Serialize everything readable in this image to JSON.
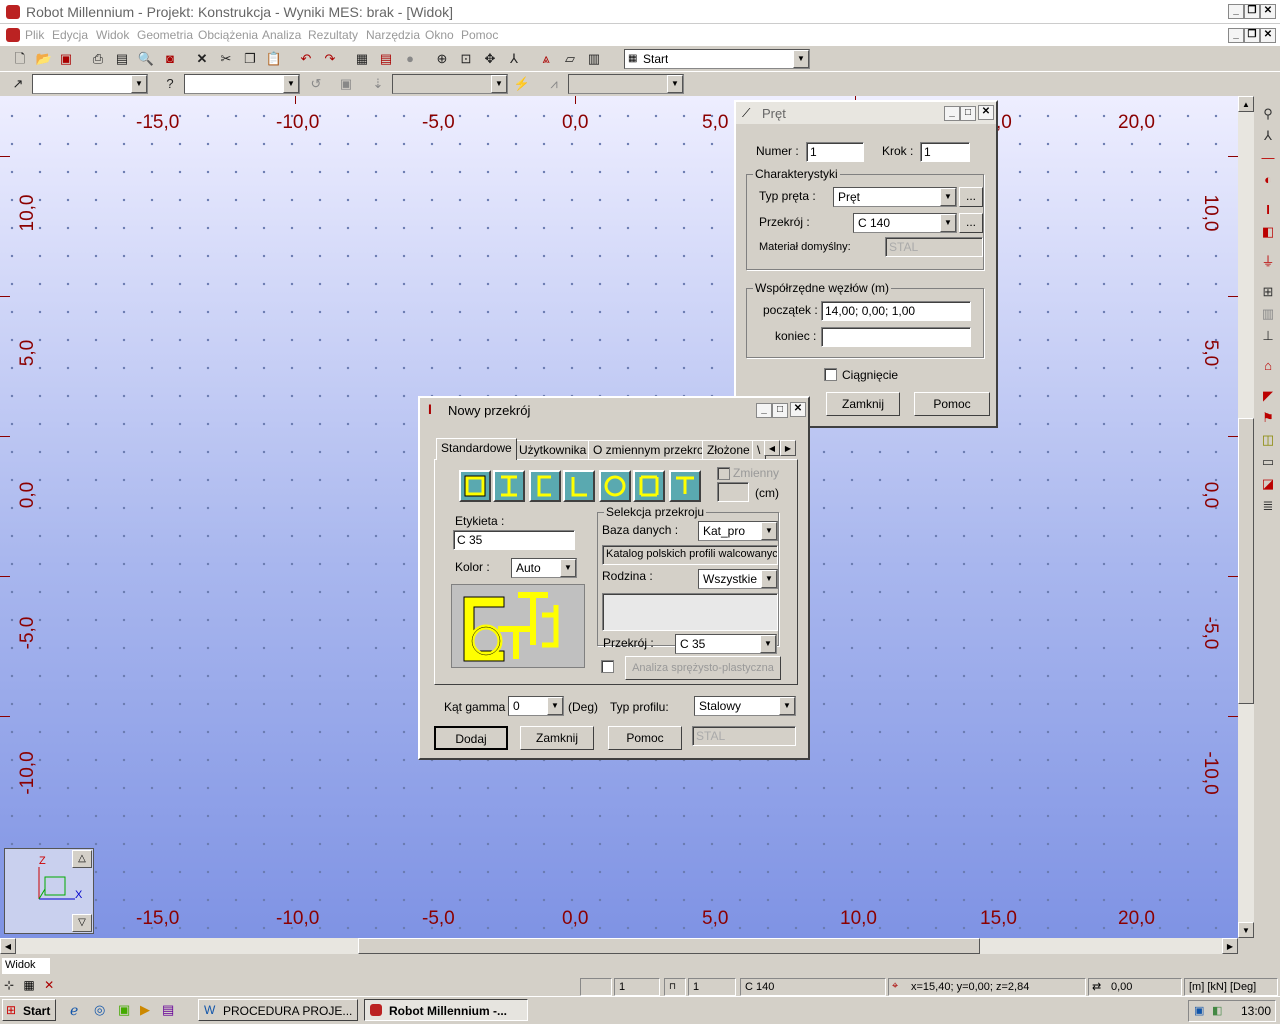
{
  "window": {
    "title": "Robot Millennium - Projekt: Konstrukcja - Wyniki MES: brak - [Widok]"
  },
  "menu": [
    "Plik",
    "Edycja",
    "Widok",
    "Geometria",
    "Obciążenia",
    "Analiza",
    "Rezultaty",
    "Narzędzia",
    "Okno",
    "Pomoc"
  ],
  "toolbar": {
    "layout_combo": "Start"
  },
  "axes": {
    "x_top": [
      "-15,0",
      "-10,0",
      "-5,0",
      "0,0",
      "5,0",
      "20,0"
    ],
    "x_bottom": [
      "-15,0",
      "-10,0",
      "-5,0",
      "0,0",
      "5,0",
      "10,0",
      "15,0",
      "20,0"
    ],
    "y_left": [
      "10,0",
      "5,0",
      "0,0",
      "-5,0",
      "-10,0"
    ],
    "y_right": [
      "10,0",
      "5,0",
      "0,0",
      "-5,0",
      "-10,0"
    ],
    "partial_label": ",0"
  },
  "axis_widget": {
    "z": "Z",
    "x": "X"
  },
  "pret_dialog": {
    "title": "Pręt",
    "numer_label": "Numer :",
    "numer_value": "1",
    "krok_label": "Krok :",
    "krok_value": "1",
    "char_group": "Charakterystyki",
    "typ_label": "Typ pręta :",
    "typ_value": "Pręt",
    "przekroj_label": "Przekrój :",
    "przekroj_value": "C 140",
    "material_label": "Materiał domyślny:",
    "material_value": "STAL",
    "coords_group": "Współrzędne węzłów (m)",
    "poczatek_label": "początek :",
    "poczatek_value": "14,00; 0,00; 1,00",
    "koniec_label": "koniec :",
    "koniec_value": "",
    "ciagniecie_label": "Ciągnięcie",
    "zamknij": "Zamknij",
    "pomoc": "Pomoc",
    "dots": "..."
  },
  "section_dialog": {
    "title": "Nowy przekrój",
    "tabs": [
      "Standardowe",
      "Użytkownika",
      "O zmiennym przekroju",
      "Złożone",
      "\\"
    ],
    "zmienny_label": "Zmienny",
    "cm_label": "(cm)",
    "etykieta_label": "Etykieta :",
    "etykieta_value": "C 35",
    "kolor_label": "Kolor :",
    "kolor_value": "Auto",
    "selekcja_group": "Selekcja przekroju",
    "baza_label": "Baza danych :",
    "baza_value": "Kat_pro",
    "katalog_value": "Katalog polskich profili walcowanyc",
    "rodzina_label": "Rodzina :",
    "rodzina_value": "Wszystkie",
    "przekroj_label": "Przekrój :",
    "przekroj_value": "C 35",
    "analiza_label": "Analiza sprężysto-plastyczna",
    "kat_label": "Kąt gamma :",
    "kat_value": "0",
    "deg_label": "(Deg)",
    "typ_profilu_label": "Typ profilu:",
    "typ_profilu_value": "Stalowy",
    "material_value": "STAL",
    "dodaj": "Dodaj",
    "zamknij": "Zamknij",
    "pomoc": "Pomoc"
  },
  "status": {
    "view": "Widok",
    "f1": "1",
    "f2": "1",
    "section": "C 140",
    "coords": "x=15,40; y=0,00; z=2,84",
    "angle": "0,00",
    "units": "[m] [kN] [Deg]"
  },
  "taskbar": {
    "start": "Start",
    "task1": "PROCEDURA PROJE...",
    "task2": "Robot Millennium -...",
    "clock": "13:00"
  }
}
